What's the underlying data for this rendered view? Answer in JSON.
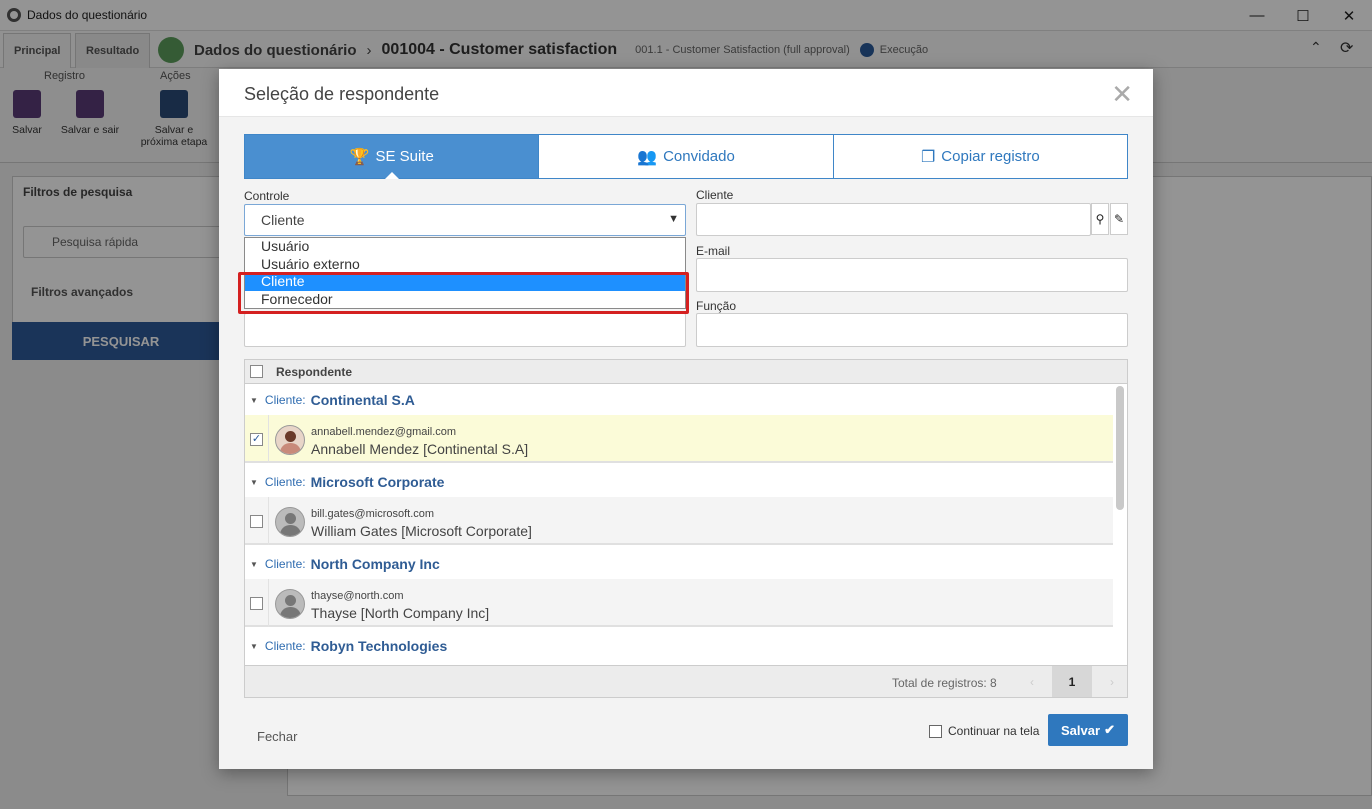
{
  "window": {
    "title": "Dados do questionário"
  },
  "app": {
    "tabs": [
      "Principal",
      "Resultado"
    ],
    "breadcrumb": {
      "section": "Dados do questionário",
      "record": "001004 - Customer satisfaction",
      "sub": "001.1 - Customer Satisfaction (full approval)",
      "status": "Execução"
    },
    "toolbar": {
      "group_registro": "Registro",
      "group_acoes": "Ações",
      "save": "Salvar",
      "save_exit": "Salvar e sair",
      "save_next_1": "Salvar e",
      "save_next_2": "próxima etapa"
    },
    "filters": {
      "title": "Filtros de pesquisa",
      "quick_search_placeholder": "Pesquisa rápida",
      "advanced": "Filtros avançados",
      "search_button": "PESQUISAR"
    }
  },
  "modal": {
    "title": "Seleção de respondente",
    "close": "✕",
    "tabs": [
      {
        "label": "SE Suite",
        "icon": "trophy-icon",
        "active": true
      },
      {
        "label": "Convidado",
        "icon": "add-user-icon",
        "active": false
      },
      {
        "label": "Copiar registro",
        "icon": "copy-icon",
        "active": false
      }
    ],
    "fields": {
      "controle_label": "Controle",
      "controle_value": "Cliente",
      "cliente_label": "Cliente",
      "email_label": "E-mail",
      "funcao_label": "Função"
    },
    "dropdown_options": [
      "Usuário",
      "Usuário externo",
      "Cliente",
      "Fornecedor"
    ],
    "dropdown_selected_index": 2,
    "grid": {
      "header": "Respondente",
      "groups": [
        {
          "key": "Cliente:",
          "name": "Continental S.A",
          "item": {
            "email": "annabell.mendez@gmail.com",
            "name": "Annabell Mendez [Continental S.A]",
            "checked": true
          }
        },
        {
          "key": "Cliente:",
          "name": "Microsoft Corporate",
          "item": {
            "email": "bill.gates@microsoft.com",
            "name": "William Gates [Microsoft Corporate]",
            "checked": false
          }
        },
        {
          "key": "Cliente:",
          "name": "North Company Inc",
          "item": {
            "email": "thayse@north.com",
            "name": "Thayse [North Company Inc]",
            "checked": false
          }
        },
        {
          "key": "Cliente:",
          "name": "Robyn Technologies"
        }
      ],
      "total": "Total de registros: 8",
      "page": "1"
    },
    "footer": {
      "close": "Fechar",
      "continue": "Continuar na tela",
      "save": "Salvar"
    }
  }
}
